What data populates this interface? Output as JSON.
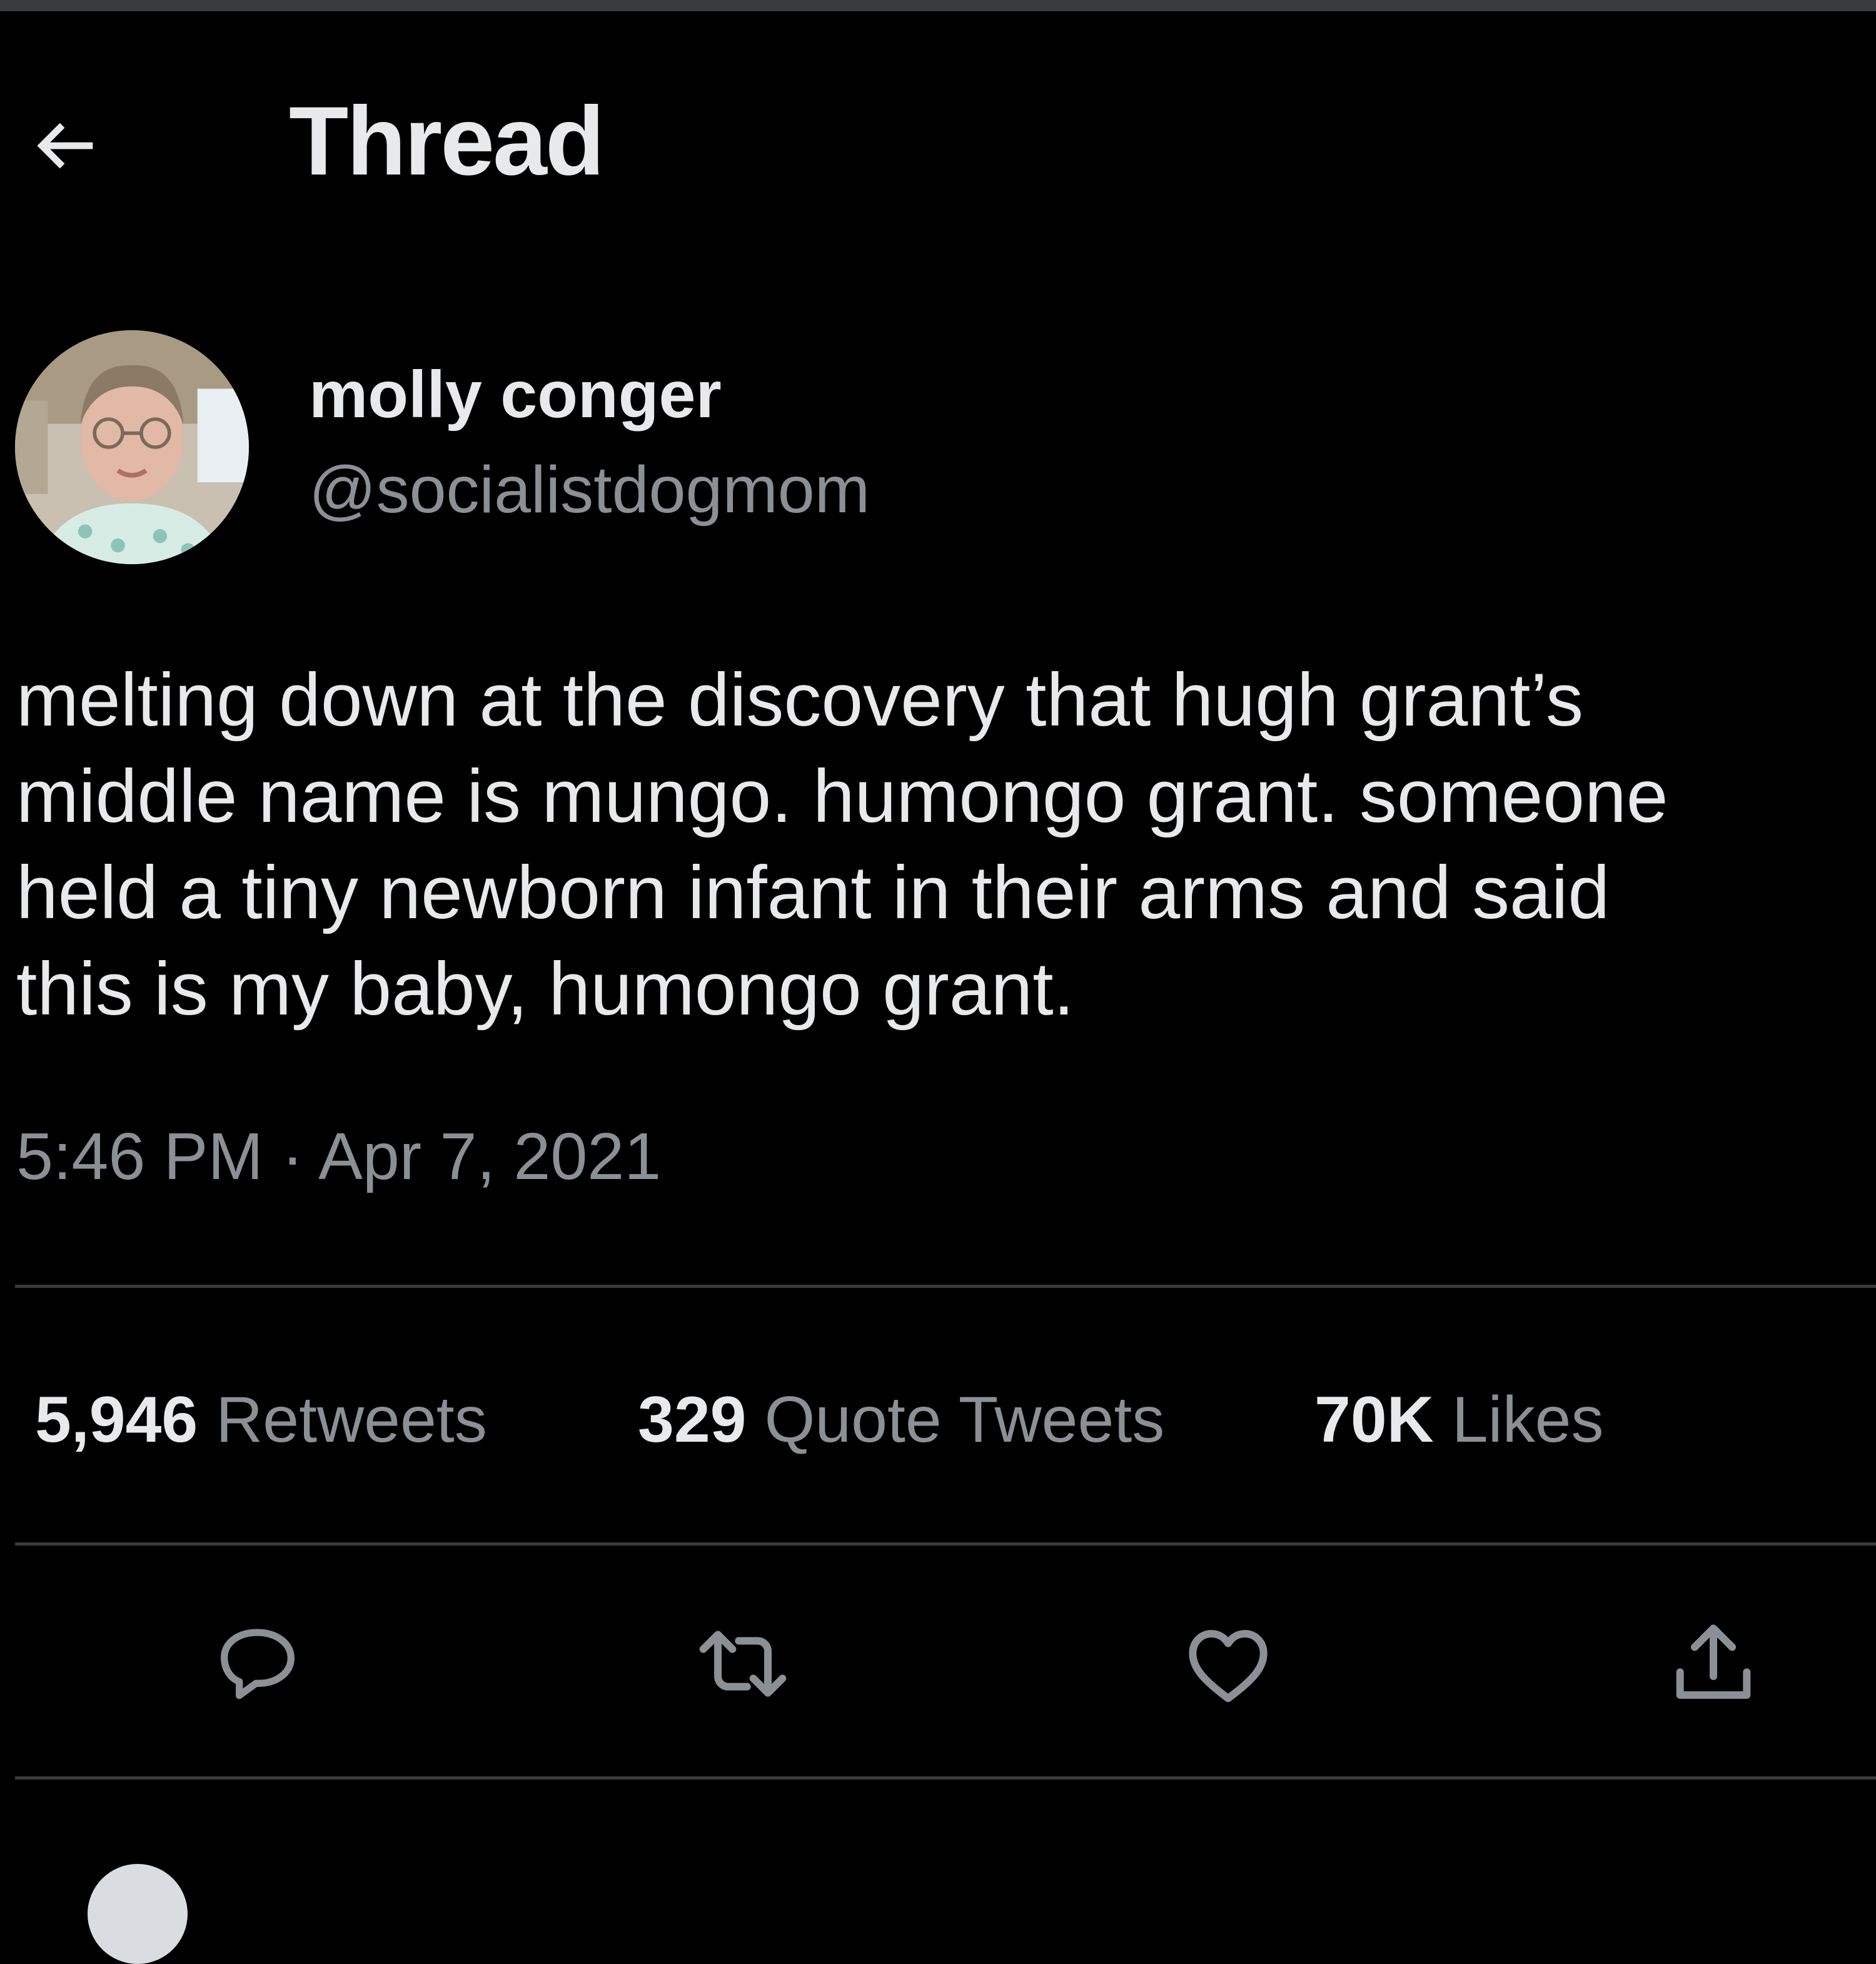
{
  "header": {
    "back_icon": "arrow-left-icon",
    "title": "Thread"
  },
  "tweet": {
    "author": {
      "display_name": "molly conger",
      "handle": "@socialistdogmom",
      "avatar_icon": "profile-photo"
    },
    "text": "melting down at the discovery that hugh grant’s\nmiddle name is mungo. humongo grant. someone\nheld a tiny newborn infant in their arms and said\nthis is my baby, humongo grant.",
    "time": "5:46 PM",
    "separator": "·",
    "date": "Apr 7, 2021",
    "stats": {
      "retweets": {
        "count": "5,946",
        "label": "Retweets"
      },
      "quote_tweets": {
        "count": "329",
        "label": "Quote Tweets"
      },
      "likes": {
        "count": "70K",
        "label": "Likes"
      }
    },
    "actions": [
      {
        "name": "reply",
        "icon": "reply-icon"
      },
      {
        "name": "retweet",
        "icon": "retweet-icon"
      },
      {
        "name": "like",
        "icon": "heart-icon"
      },
      {
        "name": "share",
        "icon": "share-icon"
      }
    ]
  },
  "colors": {
    "background": "#000000",
    "primary_text": "#e7e9ea",
    "secondary_text": "#8b9096",
    "divider": "#3a3b3d"
  }
}
